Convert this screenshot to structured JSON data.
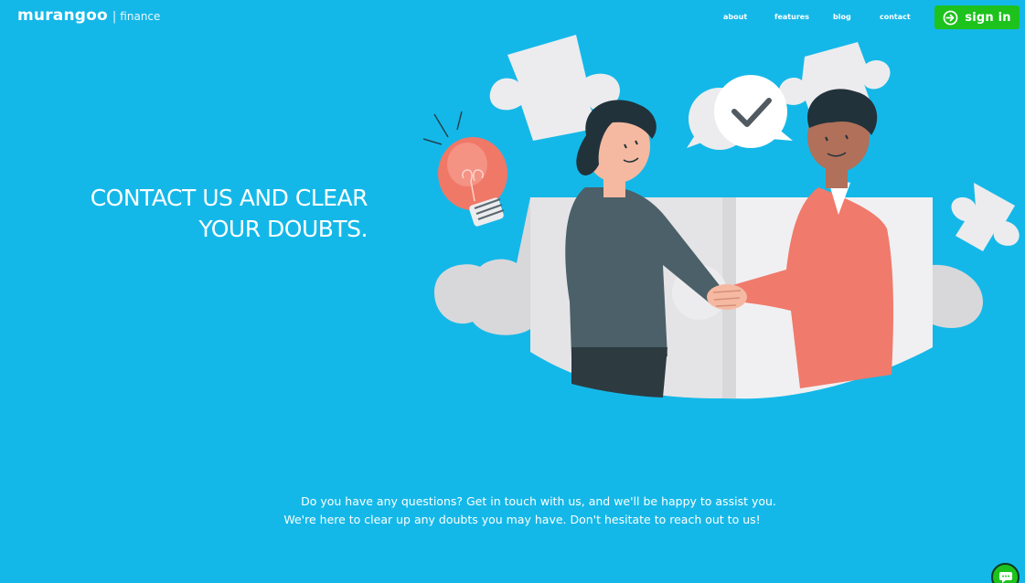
{
  "brand": {
    "name": "murangoo",
    "separator": "|",
    "subtitle": "finance"
  },
  "nav": {
    "items": [
      {
        "label": "about"
      },
      {
        "label": "features"
      },
      {
        "label": "blog"
      },
      {
        "label": "contact"
      }
    ]
  },
  "signin": {
    "label": "sign in",
    "icon": "login-arrow-icon"
  },
  "hero": {
    "title_line1": "CONTACT US AND CLEAR",
    "title_line2": "YOUR DOUBTS."
  },
  "description": {
    "line1": "Do you have any questions? Get in touch with us, and we'll be happy to assist you.",
    "line2": "We're here to clear up any doubts you may have. Don't hesitate to reach out to us!"
  },
  "chat": {
    "icon": "chat-bubble-icon"
  },
  "colors": {
    "background": "#14b8e8",
    "signin_button": "#1dc21d",
    "text": "#ffffff"
  }
}
